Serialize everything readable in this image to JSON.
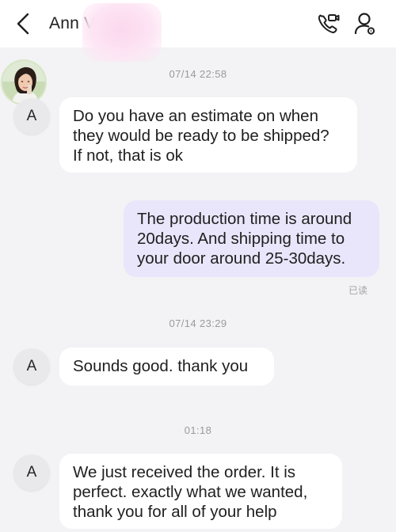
{
  "header": {
    "contact_name": "Ann V",
    "back_icon": "chevron-left-icon",
    "call_icon": "video-call-icon",
    "profile_icon": "user-settings-icon"
  },
  "messages": [
    {
      "timestamp": "07/14 22:58"
    },
    {
      "sender_initial": "A",
      "direction": "incoming",
      "text": "Do you have an estimate on when\nthey would be ready to be shipped?\nIf not, that is ok"
    },
    {
      "direction": "outgoing",
      "text": "The production time is around\n20days. And shipping time to\nyour door around 25-30days.",
      "status": "已读"
    },
    {
      "timestamp": "07/14 23:29"
    },
    {
      "sender_initial": "A",
      "direction": "incoming",
      "text": "Sounds good.  thank you"
    },
    {
      "timestamp": "01:18"
    },
    {
      "sender_initial": "A",
      "direction": "incoming",
      "text": "We just received the order.  It is\nperfect.  exactly what we wanted,\nthank you for all of your help"
    }
  ],
  "colors": {
    "background": "#f3f3f5",
    "incoming_bubble": "#ffffff",
    "outgoing_bubble": "#e9e6fb"
  }
}
